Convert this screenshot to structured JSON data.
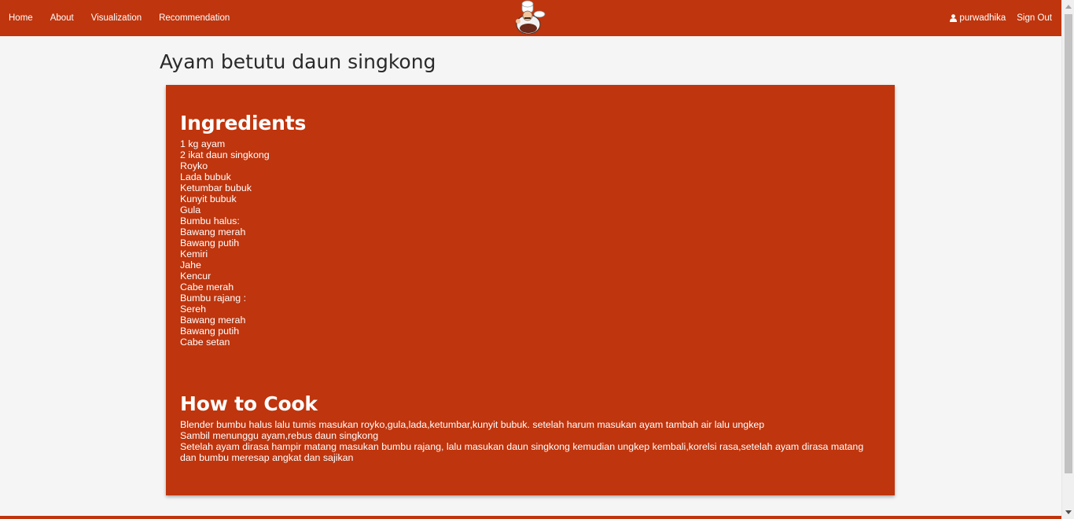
{
  "nav": {
    "links": [
      "Home",
      "About",
      "Visualization",
      "Recommendation"
    ],
    "user": "purwadhika",
    "sign_out": "Sign Out",
    "brand_color": "#bf350d",
    "logo_icon": "chef-logo-icon",
    "user_icon": "user-icon"
  },
  "recipe": {
    "title": "Ayam betutu daun singkong",
    "ingredients_heading": "Ingredients",
    "ingredients": [
      "1 kg ayam",
      "2 ikat daun singkong",
      "Royko",
      "Lada bubuk",
      "Ketumbar bubuk",
      "Kunyit bubuk",
      "Gula",
      "Bumbu halus:",
      "Bawang merah",
      "Bawang putih",
      "Kemiri",
      "Jahe",
      "Kencur",
      "Cabe merah",
      "Bumbu rajang :",
      "Sereh",
      "Bawang merah",
      "Bawang putih",
      "Cabe setan"
    ],
    "cook_heading": "How to Cook",
    "steps": [
      "Blender bumbu halus lalu tumis masukan royko,gula,lada,ketumbar,kunyit bubuk. setelah harum masukan ayam tambah air lalu ungkep",
      "Sambil menunggu ayam,rebus daun singkong",
      "Setelah ayam dirasa hampir matang masukan bumbu rajang, lalu masukan daun singkong kemudian ungkep kembali,korelsi rasa,setelah ayam dirasa matang dan bumbu meresap angkat dan sajikan"
    ]
  }
}
